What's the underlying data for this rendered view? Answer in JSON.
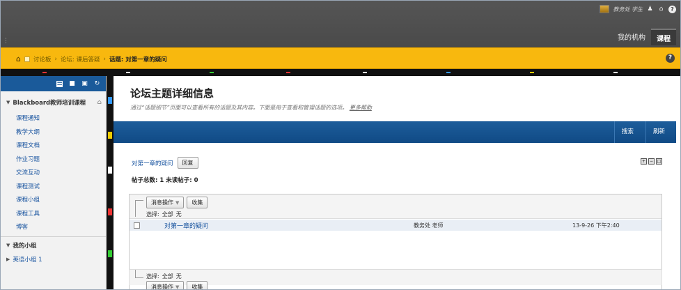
{
  "header": {
    "user_name": "教务处 学生",
    "nav_tabs": [
      {
        "label": "我的机构",
        "active": false
      },
      {
        "label": "课程",
        "active": true
      }
    ]
  },
  "breadcrumb": {
    "items": [
      "讨论板",
      "论坛: 课后答疑"
    ],
    "current": "话题: 对第一章的疑问",
    "separator": "›"
  },
  "sidebar": {
    "course_title": "Blackboard教师培训课程",
    "items": [
      {
        "label": "课程通知"
      },
      {
        "label": "教学大纲"
      },
      {
        "label": "课程文档"
      },
      {
        "label": "作业习题"
      },
      {
        "label": "交流互动"
      },
      {
        "label": "课程测试"
      },
      {
        "label": "课程小组"
      },
      {
        "label": "课程工具"
      },
      {
        "label": "博客"
      }
    ],
    "groups_title": "我的小组",
    "groups": [
      {
        "label": "英语小组 1"
      }
    ]
  },
  "main": {
    "title": "论坛主题详细信息",
    "description": "通过“话题细节”页面可以查看所有的话题及其内容。下面是用于查看和管理话题的选项。",
    "more_help": "更多帮助",
    "actions": {
      "search": "搜索",
      "refresh": "刷新"
    },
    "thread_link": "对第一章的疑问",
    "reply_button": "回复",
    "counts": {
      "total_label": "帖子总数:",
      "total": "1",
      "unread_label": "未读帖子:",
      "unread": "0"
    },
    "toolbar": {
      "message_actions": "消息操作",
      "collect": "收集"
    },
    "select": {
      "label": "选择:",
      "all": "全部",
      "none": "无"
    },
    "messages": [
      {
        "title": "对第一章的疑问",
        "author": "教务处 老师",
        "time": "13-9-26 下午2:40"
      }
    ]
  },
  "colors": {
    "topbar": "#4a4a4a",
    "breadcrumb_bar": "#f8b80e",
    "action_bar": "#1d5d9b",
    "link": "#1a55a0"
  }
}
